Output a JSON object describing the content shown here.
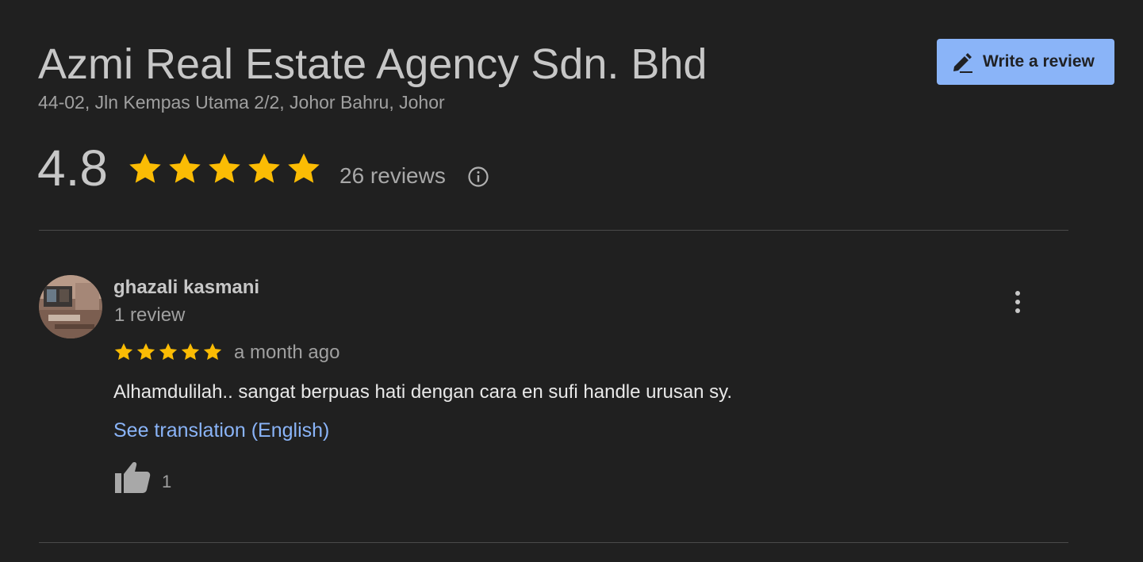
{
  "business": {
    "name": "Azmi Real Estate Agency Sdn. Bhd",
    "address": "44-02, Jln Kempas Utama 2/2, Johor Bahru, Johor"
  },
  "actions": {
    "write_review_label": "Write a review",
    "write_review_icon": "pencil-icon"
  },
  "rating": {
    "average": "4.8",
    "stars_filled": 5,
    "stars_total": 5,
    "review_count_label": "26 reviews",
    "info_icon": "info-icon"
  },
  "reviews": [
    {
      "author": "ghazali kasmani",
      "author_meta": "1 review",
      "stars": 5,
      "date": "a month ago",
      "text": "Alhamdulilah.. sangat berpuas hati dengan cara en sufi handle urusan sy.",
      "translate_label": "See translation (English)",
      "like_count": "1",
      "like_icon": "thumbs-up-icon",
      "menu_icon": "more-vert-icon"
    }
  ],
  "colors": {
    "background": "#202020",
    "accent": "#8ab4f8",
    "star": "#fbbc04",
    "text_primary": "#c7c7c7",
    "text_secondary": "#a0a0a0",
    "divider": "#4a4a4a"
  }
}
